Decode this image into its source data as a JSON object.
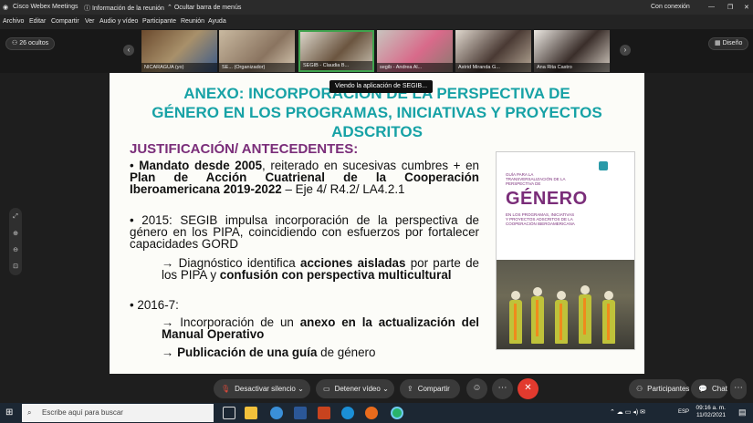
{
  "titlebar": {
    "app_title": "Cisco Webex Meetings",
    "meeting_info": "Información de la reunión",
    "hide_menu": "Ocultar barra de menús",
    "status": "Con conexión"
  },
  "menu": [
    "Archivo",
    "Editar",
    "Compartir",
    "Ver",
    "Audio y vídeo",
    "Participante",
    "Reunión",
    "Ayuda"
  ],
  "participants": {
    "hidden_count": "26 ocultos",
    "layout_label": "Diseño",
    "thumbs": [
      "NICARAGUA (yo)",
      "SE... (Organizador)",
      "SEGIB - Claudia B...",
      "segib - Andrea Al...",
      "Astrid Miranda G...",
      "Ana Rita Castro"
    ]
  },
  "tooltip": "Viendo la aplicación de SEGIB...",
  "slide": {
    "title_lines": [
      "ANEXO: INCORPORACIÓN DE LA PERSPECTIVA DE",
      "GÉNERO EN LOS PROGRAMAS, INICIATIVAS Y PROYECTOS",
      "ADSCRITOS"
    ],
    "subtitle": "JUSTIFICACIÓN/ ANTECEDENTES:",
    "b1_a": "• ",
    "b1_b": "Mandato desde 2005",
    "b1_c": ", reiterado en sucesivas cumbres + en ",
    "b1_d": "Plan de Acción Cuatrienal de la Cooperación Iberoamericana 2019-2022",
    "b1_e": " – Eje 4/ R4.2/ LA4.2.1",
    "b2": "• 2015: SEGIB impulsa incorporación de la perspectiva de género en los PIPA, coincidiendo con esfuerzos por fortalecer capacidades GORD",
    "b3_a": "→ Diagnóstico identifica ",
    "b3_b": "acciones aisladas",
    "b3_c": " por parte de los PIPA y ",
    "b3_d": "confusión con perspectiva multicultural",
    "b4": "• 2016-7:",
    "b5_a": "→ Incorporación de un ",
    "b5_b": "anexo en la actualización del Manual Operativo",
    "b6_a": "→ ",
    "b6_b": "Publicación de una guía",
    "b6_c": " de género",
    "cover": {
      "big": "GÉNERO",
      "top_text": "GUÍA PARA LA TRANSVERSALIZACIÓN DE LA PERSPECTIVA DE",
      "sub_text": "EN LOS PROGRAMAS, INICIATIVAS Y PROYECTOS ADSCRITOS DE LA COOPERACIÓN IBEROAMERICANA"
    }
  },
  "controls": {
    "mute": "Desactivar silencio",
    "video": "Detener vídeo",
    "share": "Compartir",
    "participants": "Participantes",
    "chat": "Chat"
  },
  "taskbar": {
    "search_placeholder": "Escribe aquí para buscar",
    "time": "09:16 a. m.",
    "date": "11/02/2021",
    "lang": "ESP"
  },
  "colors": {
    "title_teal": "#17a2a6",
    "subtitle_purple": "#7a2d79",
    "end_red": "#e23a2e"
  }
}
